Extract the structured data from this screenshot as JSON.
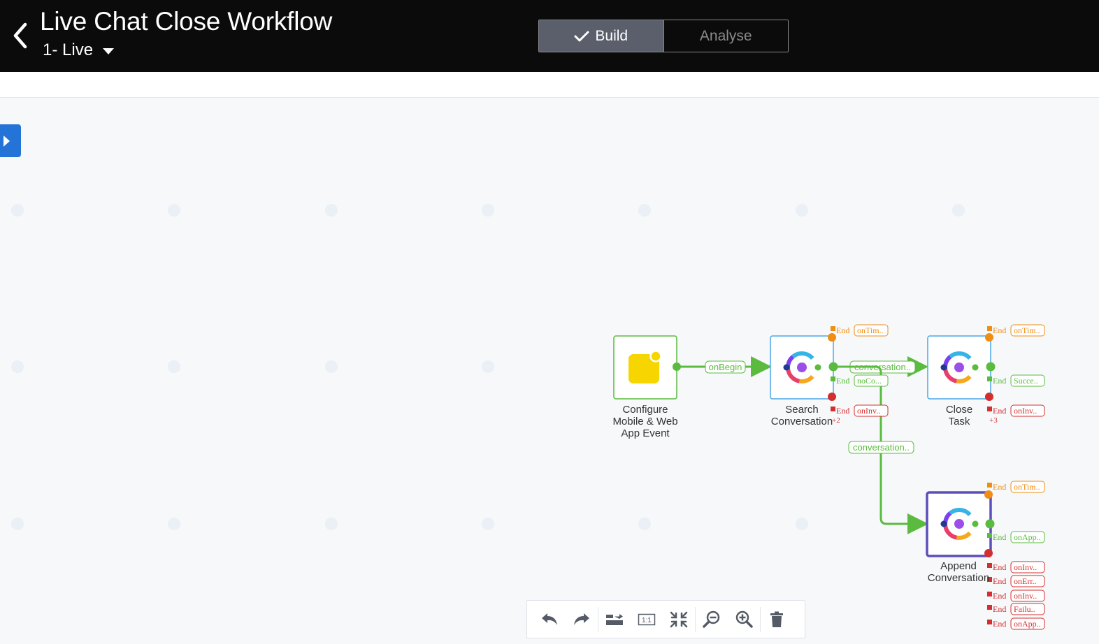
{
  "header": {
    "title": "Live Chat Close Workflow",
    "version": "1- Live",
    "tabs": {
      "build": "Build",
      "analyse": "Analyse"
    }
  },
  "nodes": {
    "trigger": {
      "label_lines": [
        "Configure",
        "Mobile & Web",
        "App Event"
      ]
    },
    "search": {
      "label_lines": [
        "Search",
        "Conversation"
      ],
      "more": "+2"
    },
    "close": {
      "label_lines": [
        "Close",
        "Task"
      ],
      "more": "+3"
    },
    "append": {
      "label_lines": [
        "Append",
        "Conversation"
      ]
    }
  },
  "edges": {
    "on_begin": "onBegin",
    "search_to_close": "conversation..",
    "search_to_append": "conversation.."
  },
  "end_word": "End",
  "end_tags": {
    "search": [
      "onTim..",
      "noCo...",
      "onInv.."
    ],
    "close": [
      "onTim..",
      "Succe..",
      "onInv.."
    ],
    "append": [
      "onTim..",
      "onApp..",
      "onInv..",
      "onErr..",
      "onInv..",
      "Failu..",
      "onApp.."
    ]
  },
  "colors": {
    "success": "#5abb3f",
    "warning": "#f18d13",
    "error": "#d42f2f",
    "accent": "#2474d8",
    "selected": "#5b4fbb"
  },
  "toolbar_icons": [
    "undo-icon",
    "redo-icon",
    "auto-layout-icon",
    "actual-size-icon",
    "fit-to-screen-icon",
    "zoom-out-icon",
    "zoom-in-icon",
    "delete-icon"
  ]
}
